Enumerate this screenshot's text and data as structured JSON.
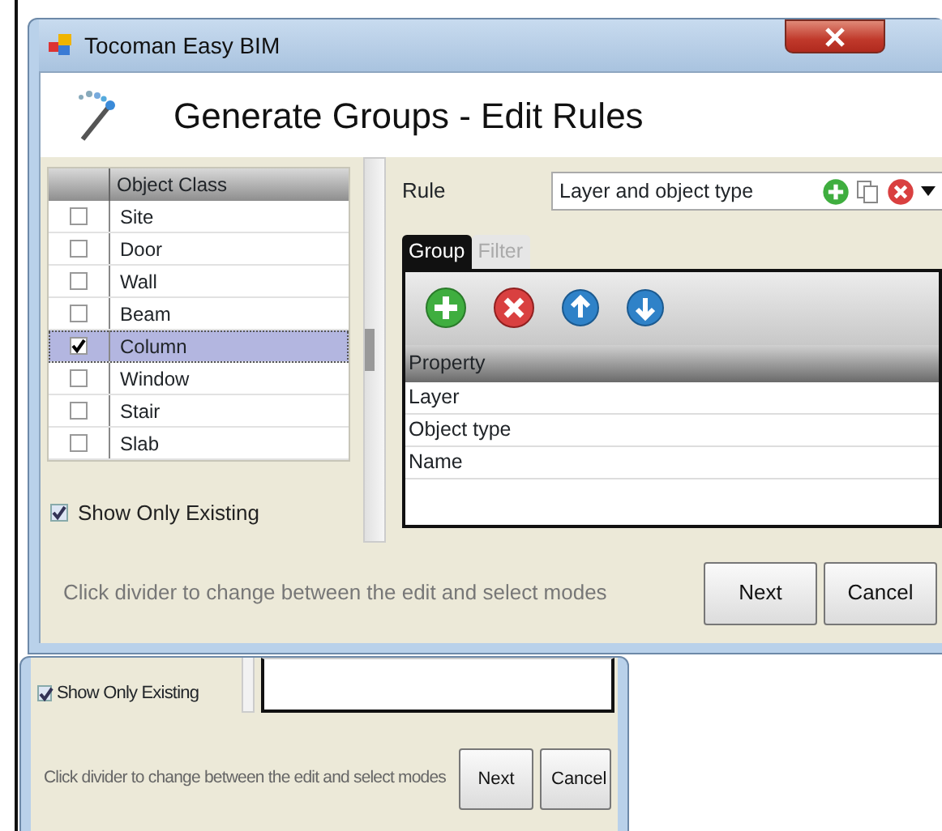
{
  "main_window": {
    "title": "Tocoman Easy BIM",
    "heading": "Generate Groups - Edit Rules",
    "object_class": {
      "column": "Object Class",
      "items": [
        {
          "label": "Site",
          "checked": false,
          "selected": false
        },
        {
          "label": "Door",
          "checked": false,
          "selected": false
        },
        {
          "label": "Wall",
          "checked": false,
          "selected": false
        },
        {
          "label": "Beam",
          "checked": false,
          "selected": false
        },
        {
          "label": "Column",
          "checked": true,
          "selected": true
        },
        {
          "label": "Window",
          "checked": false,
          "selected": false
        },
        {
          "label": "Stair",
          "checked": false,
          "selected": false
        },
        {
          "label": "Slab",
          "checked": false,
          "selected": false
        }
      ]
    },
    "show_only_existing": {
      "label": "Show Only Existing",
      "checked": true
    },
    "rule": {
      "label": "Rule",
      "value": "Layer and object type"
    },
    "tabs": [
      {
        "label": "Group",
        "selected": true
      },
      {
        "label": "Filter",
        "selected": false
      }
    ],
    "property_table": {
      "column": "Property",
      "rows": [
        "Layer",
        "Object type",
        "Name"
      ]
    },
    "hint": "Click divider to change between the edit and select modes",
    "buttons": [
      "Next",
      "Cancel"
    ]
  },
  "background_window": {
    "show_only_existing": {
      "label": "Show Only Existing",
      "checked": true
    },
    "hint": "Click divider to change between the edit and select modes",
    "buttons": [
      "Next",
      "Cancel"
    ]
  }
}
